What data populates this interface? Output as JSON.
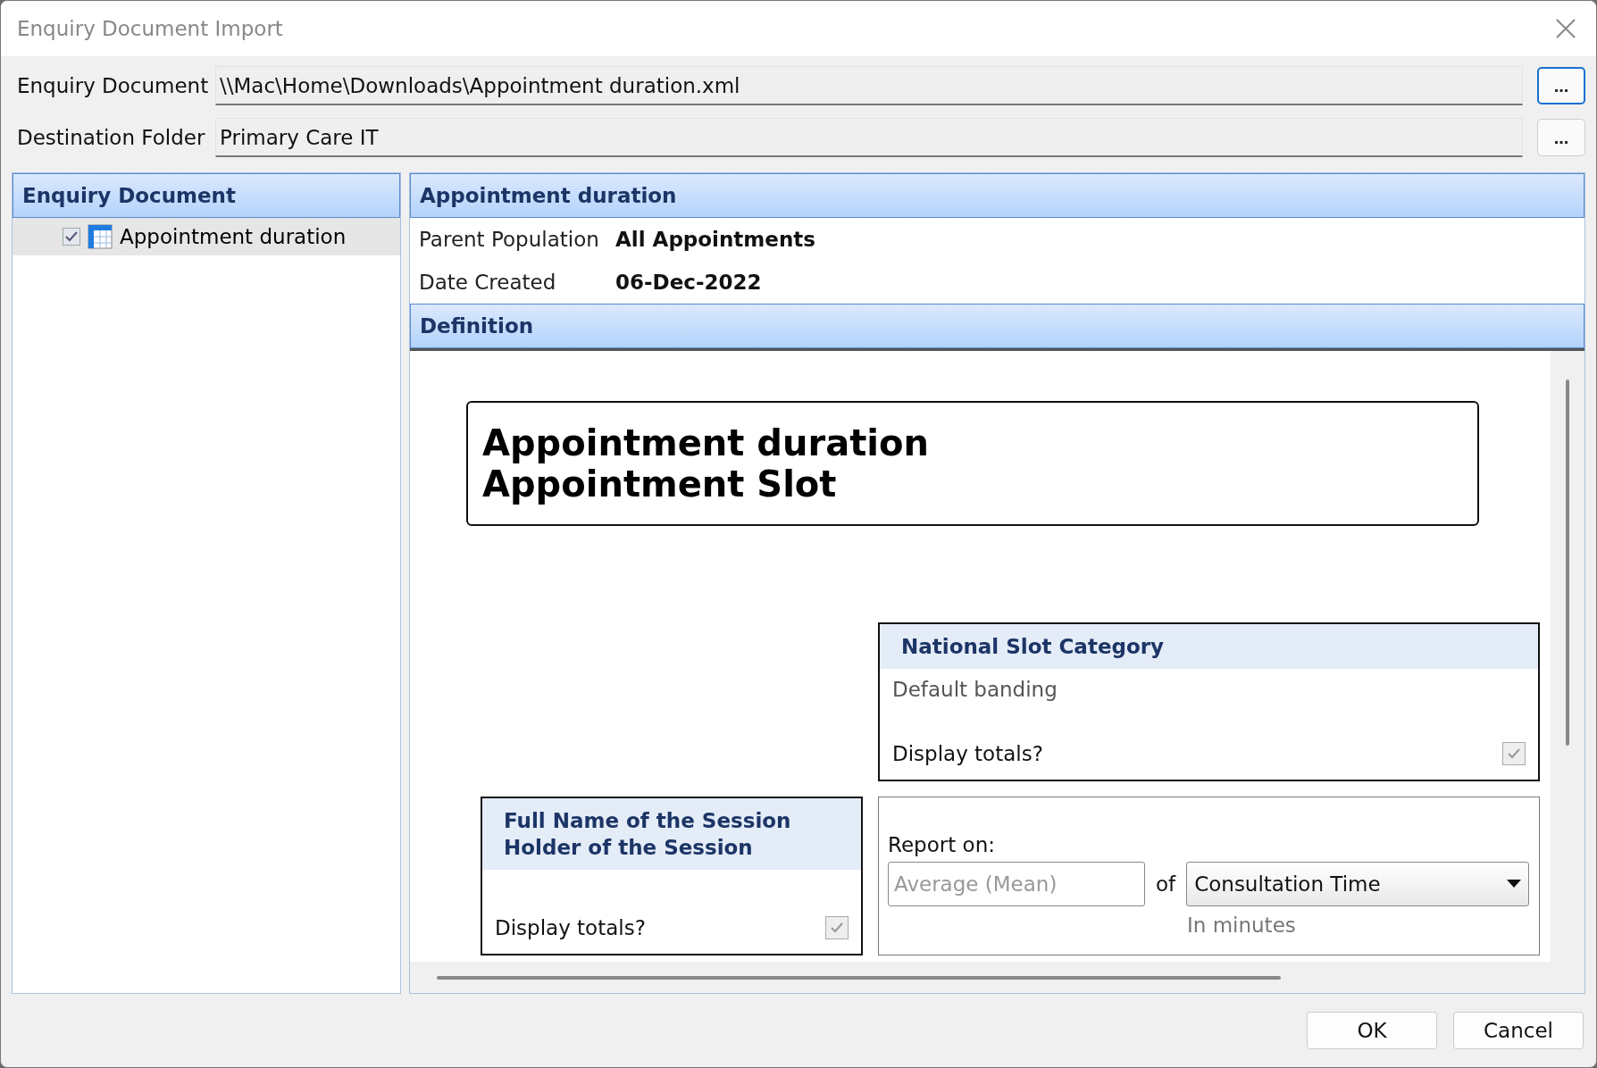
{
  "window": {
    "title": "Enquiry Document Import"
  },
  "fields": [
    {
      "label": "Enquiry Document",
      "value": "\\\\Mac\\Home\\Downloads\\Appointment duration.xml",
      "browse": "...",
      "focused": true
    },
    {
      "label": "Destination Folder",
      "value": "Primary Care IT",
      "browse": "...",
      "focused": false
    }
  ],
  "tree_panel": {
    "title": "Enquiry Document",
    "items": [
      {
        "label": "Appointment duration",
        "checked": true,
        "selected": true
      }
    ]
  },
  "details_panel": {
    "title": "Appointment duration",
    "properties": [
      {
        "label": "Parent Population",
        "value": "All Appointments"
      },
      {
        "label": "Date Created",
        "value": "06-Dec-2022"
      }
    ]
  },
  "definition": {
    "title": "Definition",
    "heading_lines": [
      "Appointment duration",
      "Appointment Slot"
    ],
    "cards": [
      {
        "kind": "category",
        "title": "National Slot Category",
        "subtitle": "Default banding",
        "totals_label": "Display totals?",
        "totals_checked": true
      },
      {
        "kind": "category",
        "title": "Full Name of the Session Holder of the Session",
        "totals_label": "Display totals?",
        "totals_checked": true
      },
      {
        "kind": "report",
        "label": "Report on:",
        "placeholder": "Average (Mean)",
        "connector": "of",
        "dropdown": "Consultation Time",
        "note": "In minutes"
      }
    ]
  },
  "buttons": [
    {
      "label": "OK"
    },
    {
      "label": "Cancel"
    }
  ]
}
